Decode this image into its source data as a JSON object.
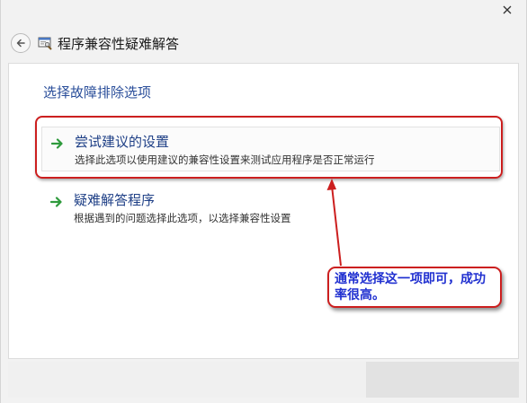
{
  "window": {
    "title": "程序兼容性疑难解答"
  },
  "main": {
    "heading": "选择故障排除选项",
    "options": [
      {
        "title": "尝试建议的设置",
        "description": "选择此选项以使用建议的兼容性设置来测试应用程序是否正常运行"
      },
      {
        "title": "疑难解答程序",
        "description": "根据遇到的问题选择此选项，以选择兼容性设置"
      }
    ]
  },
  "annotation": {
    "callout_text": "通常选择这一项即可，成功率很高。"
  },
  "colors": {
    "heading": "#2a4e9a",
    "option_title": "#1e3f86",
    "annotation_red": "#cc1f1f",
    "callout_text": "#1f2fd0",
    "arrow_green": "#2e9a3c"
  },
  "icons": {
    "close": "close-icon",
    "back": "back-arrow-icon",
    "app": "compatibility-troubleshooter-icon",
    "option_arrow": "green-arrow-icon"
  }
}
